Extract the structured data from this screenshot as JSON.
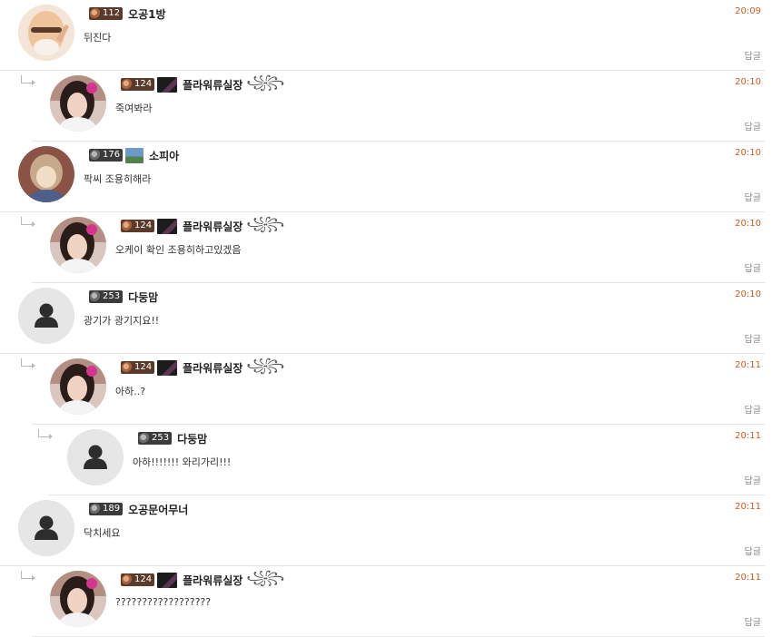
{
  "comments": [
    {
      "depth": 0,
      "avatar": "elder-avatar",
      "level": "112",
      "level_style": "bronze",
      "badge": "",
      "nick": "오공1방",
      "deco": "",
      "text": "뒤진다",
      "time": "20:09",
      "reply": "답글"
    },
    {
      "depth": 1,
      "avatar": "woman-avatar",
      "level": "124",
      "level_style": "bronze",
      "badge": "dark",
      "nick": "플라워류실장",
      "deco": "꧁꧂",
      "text": "죽여봐라",
      "time": "20:10",
      "reply": "답글"
    },
    {
      "depth": 0,
      "avatar": "anime-avatar",
      "level": "176",
      "level_style": "silver",
      "badge": "sky",
      "nick": "소피아",
      "deco": "",
      "text": "팍씨 조용히해라",
      "time": "20:10",
      "reply": "답글"
    },
    {
      "depth": 1,
      "avatar": "woman-avatar",
      "level": "124",
      "level_style": "bronze",
      "badge": "dark",
      "nick": "플라워류실장",
      "deco": "꧁꧂",
      "text": "오케이 확인 조용히하고있겠음",
      "time": "20:10",
      "reply": "답글"
    },
    {
      "depth": 0,
      "avatar": "default-avatar",
      "level": "253",
      "level_style": "silver",
      "badge": "",
      "nick": "다둥맘",
      "deco": "",
      "text": "광기가 광기지요!!",
      "time": "20:10",
      "reply": "답글"
    },
    {
      "depth": 1,
      "avatar": "woman-avatar",
      "level": "124",
      "level_style": "bronze",
      "badge": "dark",
      "nick": "플라워류실장",
      "deco": "꧁꧂",
      "text": "아하..?",
      "time": "20:11",
      "reply": "답글"
    },
    {
      "depth": 2,
      "avatar": "default-avatar",
      "level": "253",
      "level_style": "silver",
      "badge": "",
      "nick": "다둥맘",
      "deco": "",
      "text": "아하!!!!!!! 와리가리!!!",
      "time": "20:11",
      "reply": "답글"
    },
    {
      "depth": 0,
      "avatar": "default-avatar",
      "level": "189",
      "level_style": "silver",
      "badge": "",
      "nick": "오공문어무너",
      "deco": "",
      "text": "닥치세요",
      "time": "20:11",
      "reply": "답글"
    },
    {
      "depth": 1,
      "avatar": "woman-avatar",
      "level": "124",
      "level_style": "bronze",
      "badge": "dark",
      "nick": "플라워류실장",
      "deco": "꧁꧂",
      "text": "??????????????????",
      "time": "20:11",
      "reply": "답글"
    }
  ]
}
